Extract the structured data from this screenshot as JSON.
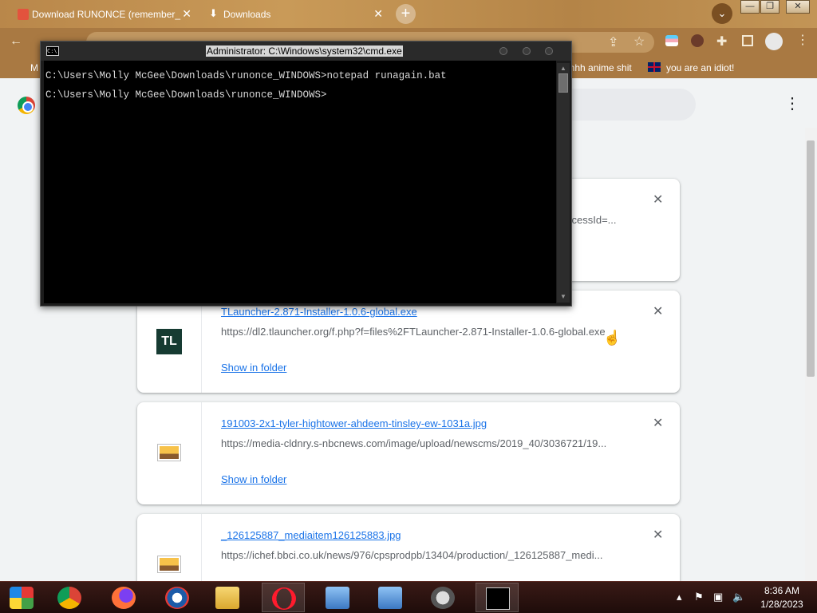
{
  "browser": {
    "tabs": [
      {
        "title": "Download RUNONCE (remember_",
        "active": false
      },
      {
        "title": "Downloads",
        "active": true
      }
    ],
    "window_controls": {
      "minimize": "—",
      "maximize": "❐",
      "close": "✕"
    },
    "bookmarks": [
      {
        "label": "M"
      },
      {
        "label": "hhhh anime shit"
      },
      {
        "label": "you are an idiot!"
      }
    ]
  },
  "downloads": {
    "cards": [
      {
        "file_name": "",
        "url": "ccessId=...",
        "icon": "generic-file-icon",
        "action": ""
      },
      {
        "file_name": "TLauncher-2.871-Installer-1.0.6-global.exe",
        "url": "https://dl2.tlauncher.org/f.php?f=files%2FTLauncher-2.871-Installer-1.0.6-global.exe",
        "icon_text": "TL",
        "action": "Show in folder"
      },
      {
        "file_name": "191003-2x1-tyler-hightower-ahdeem-tinsley-ew-1031a.jpg",
        "url": "https://media-cldnry.s-nbcnews.com/image/upload/newscms/2019_40/3036721/19...",
        "icon": "image-file-icon",
        "action": "Show in folder"
      },
      {
        "file_name": "_126125887_mediaitem126125883.jpg",
        "url": "https://ichef.bbci.co.uk/news/976/cpsprodpb/13404/production/_126125887_medi...",
        "icon": "image-file-icon",
        "action": ""
      }
    ]
  },
  "cmd": {
    "title": "Administrator: C:\\Windows\\system32\\cmd.exe",
    "lines": [
      "C:\\Users\\Molly McGee\\Downloads\\runonce_WINDOWS>notepad runagain.bat",
      "C:\\Users\\Molly McGee\\Downloads\\runonce_WINDOWS>"
    ]
  },
  "taskbar": {
    "clock_time": "8:36 AM",
    "clock_date": "1/28/2023",
    "items": [
      "windows-media-center-icon",
      "chrome-icon",
      "firefox-icon",
      "obama-logo-icon",
      "file-explorer-icon",
      "opera-icon",
      "network-setup-icon",
      "network-setup-icon-2",
      "skull-app-icon",
      "cmd-icon"
    ]
  },
  "colors": {
    "accent_link": "#1a73e8",
    "cmd_bg": "#000000",
    "taskbar_bg": "#2a1210"
  }
}
